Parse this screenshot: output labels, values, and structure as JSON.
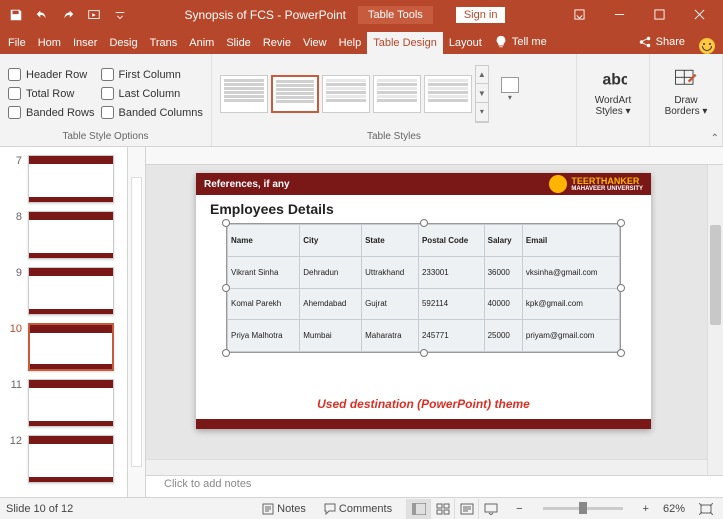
{
  "titlebar": {
    "doc_title": "Synopsis of FCS",
    "app_name": "PowerPoint",
    "tools_context": "Table Tools",
    "sign_in": "Sign in"
  },
  "tabs": {
    "file": "File",
    "home": "Home",
    "insert": "Insert",
    "design": "Design",
    "transitions": "Transitions",
    "animations": "Animations",
    "slideshow": "Slide Show",
    "review": "Review",
    "view": "View",
    "help": "Help",
    "table_design": "Table Design",
    "layout": "Layout",
    "tell_me": "Tell me",
    "share": "Share"
  },
  "ribbon": {
    "options": {
      "header_row": "Header Row",
      "total_row": "Total Row",
      "banded_rows": "Banded Rows",
      "first_column": "First Column",
      "last_column": "Last Column",
      "banded_columns": "Banded Columns",
      "group_label": "Table Style Options"
    },
    "styles": {
      "group_label": "Table Styles"
    },
    "wordart": {
      "label_l1": "WordArt",
      "label_l2": "Styles"
    },
    "borders": {
      "label_l1": "Draw",
      "label_l2": "Borders"
    }
  },
  "thumbnails": [
    {
      "num": "7"
    },
    {
      "num": "8"
    },
    {
      "num": "9"
    },
    {
      "num": "10",
      "active": true
    },
    {
      "num": "11"
    },
    {
      "num": "12"
    }
  ],
  "slide": {
    "header_left": "References, if any",
    "brand_l1": "TEERTHANKER",
    "brand_l2": "MAHAVEER UNIVERSITY",
    "title": "Employees Details",
    "caption": "Used destination (PowerPoint) theme"
  },
  "chart_data": {
    "type": "table",
    "columns": [
      "Name",
      "City",
      "State",
      "Postal Code",
      "Salary",
      "Email"
    ],
    "rows": [
      [
        "Vikrant Sinha",
        "Dehradun",
        "Uttrakhand",
        "233001",
        "36000",
        "vksinha@gmail.com"
      ],
      [
        "Komal Parekh",
        "Ahemdabad",
        "Gujrat",
        "592114",
        "40000",
        "kpk@gmail.com"
      ],
      [
        "Priya Malhotra",
        "Mumbai",
        "Maharatra",
        "245771",
        "25000",
        "priyam@gmail.com"
      ]
    ]
  },
  "notes": {
    "placeholder": "Click to add notes"
  },
  "statusbar": {
    "slide_info": "Slide 10 of 12",
    "notes": "Notes",
    "comments": "Comments",
    "zoom_pct": "62%"
  }
}
